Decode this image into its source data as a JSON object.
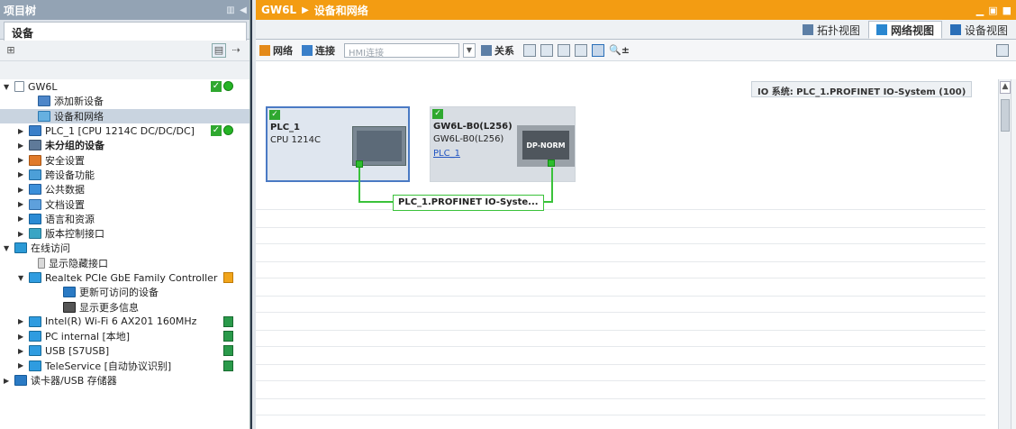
{
  "left_panel": {
    "title": "项目树",
    "tab": "设备",
    "tree": [
      {
        "label": "GW6L",
        "level": "root",
        "status": "ok"
      },
      {
        "label": "添加新设备",
        "level": "child"
      },
      {
        "label": "设备和网络",
        "level": "child",
        "selected": true
      },
      {
        "label": "PLC_1 [CPU 1214C DC/DC/DC]",
        "level": "child",
        "status": "ok"
      },
      {
        "label": "未分组的设备",
        "level": "child",
        "bold": true
      },
      {
        "label": "安全设置",
        "level": "child"
      },
      {
        "label": "跨设备功能",
        "level": "child"
      },
      {
        "label": "公共数据",
        "level": "child"
      },
      {
        "label": "文档设置",
        "level": "child"
      },
      {
        "label": "语言和资源",
        "level": "child"
      },
      {
        "label": "版本控制接口",
        "level": "child"
      },
      {
        "label": "在线访问",
        "level": "root"
      },
      {
        "label": "显示隐藏接口",
        "level": "child"
      },
      {
        "label": "Realtek PCIe GbE Family Controller",
        "level": "child"
      },
      {
        "label": "更新可访问的设备",
        "level": "grandchild"
      },
      {
        "label": "显示更多信息",
        "level": "grandchild"
      },
      {
        "label": "Intel(R) Wi-Fi 6 AX201 160MHz",
        "level": "child"
      },
      {
        "label": "PC internal [本地]",
        "level": "child"
      },
      {
        "label": "USB [S7USB]",
        "level": "child"
      },
      {
        "label": "TeleService [自动协议识别]",
        "level": "child"
      },
      {
        "label": "读卡器/USB 存储器",
        "level": "root"
      }
    ]
  },
  "right_panel": {
    "breadcrumb": [
      "GW6L",
      "设备和网络"
    ],
    "view_tabs": [
      "拓扑视图",
      "网络视图",
      "设备视图"
    ],
    "active_view": "网络视图",
    "toolbar": {
      "network": "网络",
      "connections": "连接",
      "hmi_placeholder": "HMI连接",
      "relations": "关系"
    },
    "io_system": "IO 系统: PLC_1.PROFINET IO-System (100)",
    "devices": [
      {
        "name": "PLC_1",
        "type": "CPU 1214C"
      },
      {
        "name": "GW6L-B0(L256)",
        "type": "GW6L-B0(L256)",
        "link": "PLC_1",
        "image_label": "DP-NORM"
      }
    ],
    "network_label": "PLC_1.PROFINET IO-Syste..."
  },
  "colors": {
    "left_header": "#93a3b4",
    "right_header": "#f39c12",
    "status_ok": "#2fa82f",
    "profinet_line": "#3ac23a"
  }
}
